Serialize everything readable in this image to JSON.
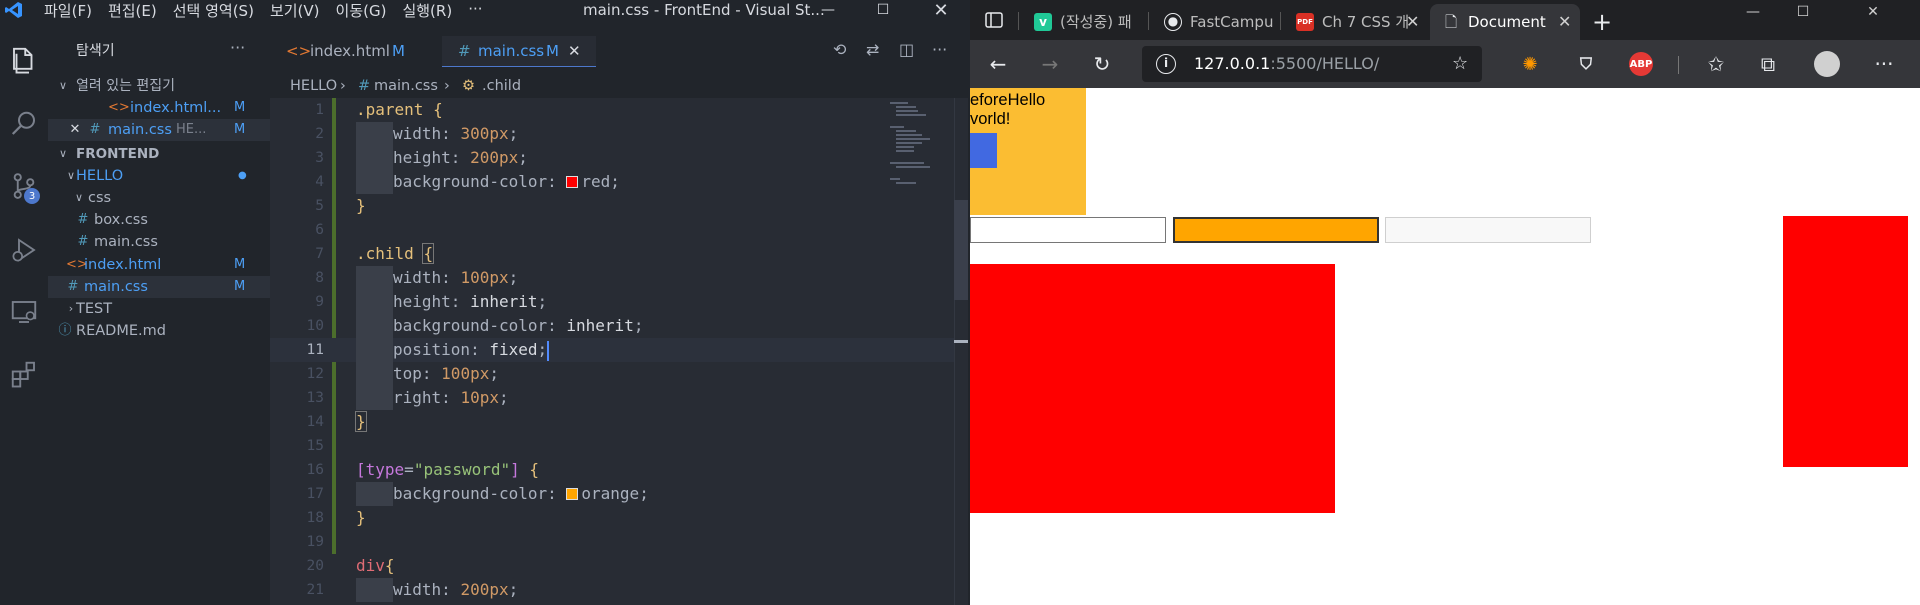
{
  "vscode": {
    "menu": [
      "파일(F)",
      "편집(E)",
      "선택 영역(S)",
      "보기(V)",
      "이동(G)",
      "실행(R)",
      "···"
    ],
    "window_title": "main.css - FrontEnd - Visual St...",
    "explorer": {
      "title": "탐색기",
      "more": "···",
      "open_editors_label": "열려 있는 편집기",
      "open_editors": [
        {
          "name": "index.html...",
          "status": "M"
        },
        {
          "name": "main.css",
          "path": "HE...",
          "status": "M"
        }
      ],
      "project_label": "FRONTEND",
      "tree": {
        "hello": "HELLO",
        "css": "css",
        "box_css": "box.css",
        "main_css_inner": "main.css",
        "index_html": "index.html",
        "index_status": "M",
        "main_css": "main.css",
        "main_status": "M",
        "test": "TEST",
        "readme": "README.md"
      }
    },
    "source_control_badge": "3",
    "tabs": [
      {
        "name": "index.html",
        "status": "M"
      },
      {
        "name": "main.css",
        "status": "M",
        "close": "✕"
      }
    ],
    "breadcrumb": [
      "HELLO",
      "main.css",
      ".child"
    ],
    "code": {
      "lines": [
        "1",
        "2",
        "3",
        "4",
        "5",
        "6",
        "7",
        "8",
        "9",
        "10",
        "11",
        "12",
        "13",
        "14",
        "15",
        "16",
        "17",
        "18",
        "19",
        "20",
        "21"
      ],
      "l1_sel": ".parent",
      "l1_brace": "{",
      "l2_prop": "width: ",
      "l2_val": "300px",
      "l2_end": ";",
      "l3_prop": "height: ",
      "l3_val": "200px",
      "l3_end": ";",
      "l4_prop": "background-color: ",
      "l4_val": "red",
      "l4_end": ";",
      "l5": "}",
      "l7_sel": ".child",
      "l7_brace": "{",
      "l8_prop": "width: ",
      "l8_val": "100px",
      "l8_end": ";",
      "l9_prop": "height: ",
      "l9_val": "inherit",
      "l9_end": ";",
      "l10_prop": "background-color: ",
      "l10_val": "inherit",
      "l10_end": ";",
      "l11_prop": "position: ",
      "l11_val": "fixed",
      "l11_end": ";",
      "l12_prop": "top: ",
      "l12_val": "100px",
      "l12_end": ";",
      "l13_prop": "right: ",
      "l13_val": "10px",
      "l13_end": ";",
      "l14": "}",
      "l16_open": "[",
      "l16_attr": "type",
      "l16_eq": "=",
      "l16_str": "\"password\"",
      "l16_close": "]",
      "l16_brace": "{",
      "l17_prop": "background-color: ",
      "l17_val": "orange",
      "l17_end": ";",
      "l18": "}",
      "l20_sel": "div",
      "l20_brace": "{",
      "l21_prop": "width: ",
      "l21_val": "200px",
      "l21_end": ";"
    },
    "colors": {
      "red": "#ff0000",
      "orange": "#ffa500"
    }
  },
  "browser": {
    "tabs": [
      {
        "label": "(작성중) 패"
      },
      {
        "label": "FastCampu"
      },
      {
        "label": "Ch 7 CSS 개"
      },
      {
        "label": "Document"
      }
    ],
    "new_tab": "+",
    "url_host": "127.0.0.1",
    "url_rest": ":5500/HELLO/",
    "extensions": [
      "ABP"
    ],
    "page": {
      "text_line1": "eforeHello",
      "text_line2": "vorld!"
    }
  }
}
